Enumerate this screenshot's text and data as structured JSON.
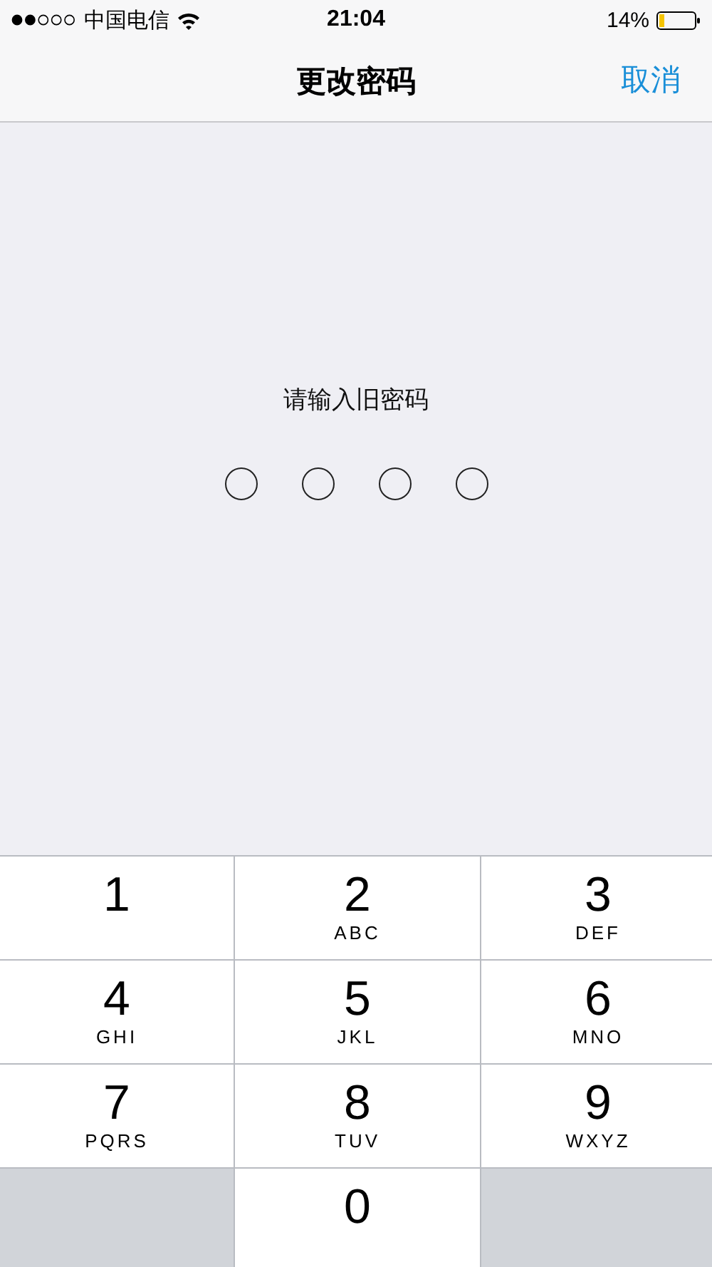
{
  "status_bar": {
    "carrier": "中国电信",
    "time": "21:04",
    "battery": "14%"
  },
  "nav": {
    "title": "更改密码",
    "cancel": "取消"
  },
  "prompt": "请输入旧密码",
  "passcode": [
    {
      "filled": false
    },
    {
      "filled": false
    },
    {
      "filled": false
    },
    {
      "filled": false
    }
  ],
  "keypad": [
    {
      "kind": "digit",
      "digit": "1"
    },
    {
      "kind": "digit",
      "digit": "2",
      "letters": "ABC"
    },
    {
      "kind": "digit",
      "digit": "3",
      "letters": "DEF"
    },
    {
      "kind": "digit",
      "digit": "4",
      "letters": "GHI"
    },
    {
      "kind": "digit",
      "digit": "5",
      "letters": "JKL"
    },
    {
      "kind": "digit",
      "digit": "6",
      "letters": "MNO"
    },
    {
      "kind": "digit",
      "digit": "7",
      "letters": "PQRS"
    },
    {
      "kind": "digit",
      "digit": "8",
      "letters": "TUV"
    },
    {
      "kind": "digit",
      "digit": "9",
      "letters": "WXYZ"
    },
    {
      "kind": "blank"
    },
    {
      "kind": "digit",
      "digit": "0"
    },
    {
      "kind": "blank"
    }
  ]
}
